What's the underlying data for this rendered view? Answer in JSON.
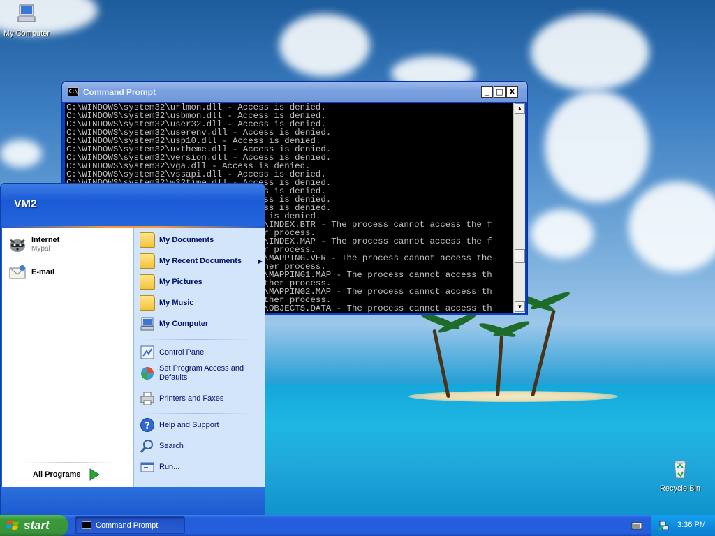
{
  "desktop": {
    "icons": [
      {
        "label": "My Computer",
        "icon": "my-computer-icon"
      },
      {
        "label": "Recycle Bin",
        "icon": "recycle-bin-icon"
      }
    ]
  },
  "cmd_window": {
    "title": "Command Prompt",
    "title_icon_text": "C:\\",
    "buttons": {
      "minimize": "_",
      "maximize": "□",
      "close": "X"
    },
    "lines": [
      "C:\\WINDOWS\\system32\\urlmon.dll - Access is denied.",
      "C:\\WINDOWS\\system32\\usbmon.dll - Access is denied.",
      "C:\\WINDOWS\\system32\\user32.dll - Access is denied.",
      "C:\\WINDOWS\\system32\\userenv.dll - Access is denied.",
      "C:\\WINDOWS\\system32\\usp10.dll - Access is denied.",
      "C:\\WINDOWS\\system32\\uxtheme.dll - Access is denied.",
      "C:\\WINDOWS\\system32\\version.dll - Access is denied.",
      "C:\\WINDOWS\\system32\\vga.dll - Access is denied.",
      "C:\\WINDOWS\\system32\\vssapi.dll - Access is denied.",
      "C:\\WINDOWS\\system32\\w32time.dll - Access is denied.",
      "C:\\WINDOWS\\system32\\wdmaud.drv - Access is denied.",
      "C:\\WINDOWS\\system32\\winhttp.dll - Access is denied.",
      "C:\\WINDOWS\\system32\\wininet.dll - Access is denied.",
      "C:\\WINDOWS\\system32\\winmm.dll - Access is denied.",
      "C:\\WINDOWS\\system32\\wbem\\Repository\\FS\\INDEX.BTR - The process cannot access the f",
      "ile because it is being used by another process.",
      "C:\\WINDOWS\\system32\\wbem\\Repository\\FS\\INDEX.MAP - The process cannot access the f",
      "ile because it is being used by another process.",
      "C:\\WINDOWS\\system32\\wbem\\Repository\\FS\\MAPPING.VER - The process cannot access the",
      " file because it is being used by another process.",
      "C:\\WINDOWS\\system32\\wbem\\Repository\\FS\\MAPPING1.MAP - The process cannot access th",
      "e file because it is being used by another process.",
      "C:\\WINDOWS\\system32\\wbem\\Repository\\FS\\MAPPING2.MAP - The process cannot access th",
      "e file because it is being used by another process.",
      "C:\\WINDOWS\\system32\\wbem\\Repository\\FS\\OBJECTS.DATA - The process cannot access th"
    ]
  },
  "start_menu": {
    "user_name": "VM2",
    "pinned": [
      {
        "title": "Internet",
        "subtitle": "Mypal"
      },
      {
        "title": "E-mail",
        "subtitle": ""
      }
    ],
    "all_programs": "All Programs",
    "right_bold": [
      {
        "label": "My Documents"
      },
      {
        "label": "My Recent Documents"
      },
      {
        "label": "My Pictures"
      },
      {
        "label": "My Music"
      },
      {
        "label": "My Computer"
      }
    ],
    "right_normal": [
      {
        "label": "Control Panel"
      },
      {
        "label": "Set Program Access and Defaults"
      },
      {
        "label": "Printers and Faxes"
      },
      {
        "label": "Help and Support"
      },
      {
        "label": "Search"
      },
      {
        "label": "Run..."
      }
    ]
  },
  "taskbar": {
    "start_label": "start",
    "task_button": "Command Prompt",
    "clock": "3:36 PM"
  },
  "colors": {
    "cmd_text": "#c0c0c0",
    "start_green": "#3a9a3a",
    "taskbar_blue": "#245edc"
  }
}
